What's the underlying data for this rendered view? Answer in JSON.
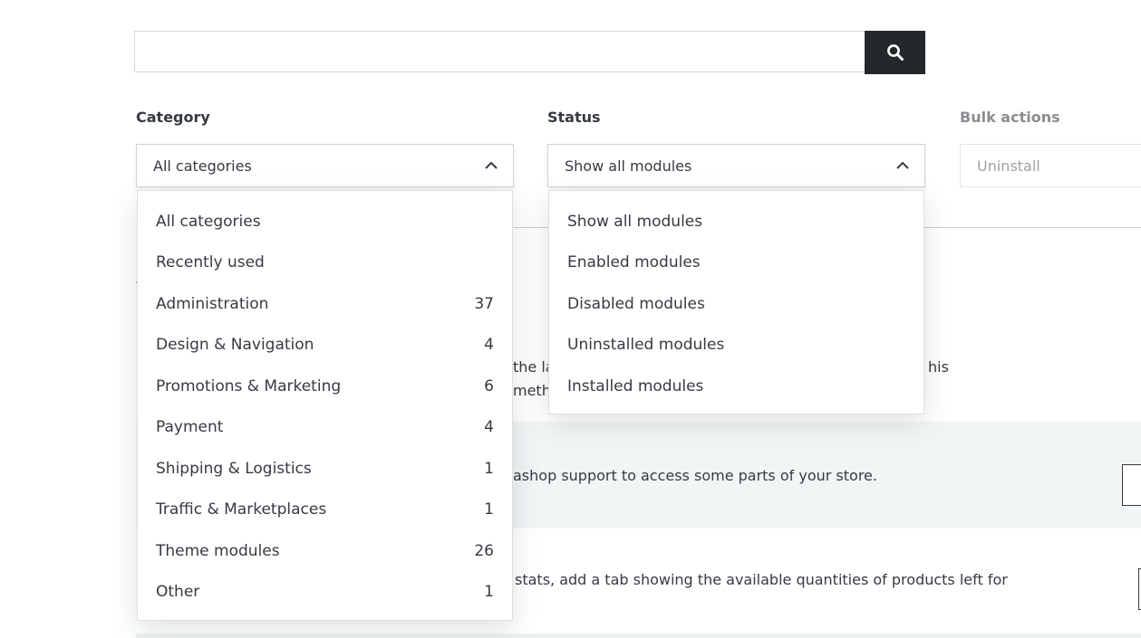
{
  "search": {
    "placeholder": "",
    "button_icon": "search-icon"
  },
  "filters": {
    "category_label": "Category",
    "status_label": "Status",
    "bulk_label": "Bulk actions",
    "category_selected": "All categories",
    "status_selected": "Show all modules",
    "bulk_selected": "Uninstall"
  },
  "category_options": [
    {
      "label": "All categories",
      "count": ""
    },
    {
      "label": "Recently used",
      "count": ""
    },
    {
      "label": "Administration",
      "count": "37"
    },
    {
      "label": "Design & Navigation",
      "count": "4"
    },
    {
      "label": "Promotions & Marketing",
      "count": "6"
    },
    {
      "label": "Payment",
      "count": "4"
    },
    {
      "label": "Shipping & Logistics",
      "count": "1"
    },
    {
      "label": "Traffic & Marketplaces",
      "count": "1"
    },
    {
      "label": "Theme modules",
      "count": "26"
    },
    {
      "label": "Other",
      "count": "1"
    }
  ],
  "status_options": [
    "Show all modules",
    "Enabled modules",
    "Disabled modules",
    "Uninstalled modules",
    "Installed modules"
  ],
  "background": {
    "line1_a": "the la",
    "line1_b": "his",
    "line2": "meth",
    "support_text": "ashop support to access some parts of your store.",
    "stats_text": "stats, add a tab showing the available quantities of products left for"
  },
  "colors": {
    "search_button": "#25282b",
    "band": "#f1f5f6"
  }
}
